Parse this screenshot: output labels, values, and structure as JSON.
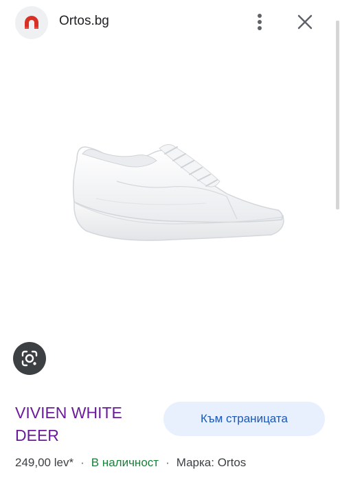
{
  "header": {
    "site_name": "Ortos.bg",
    "logo_icon": "magnet-logo-icon",
    "more_icon": "more-vert-icon",
    "close_icon": "close-icon"
  },
  "product": {
    "image_icon": "white-sneaker-image",
    "title": "VIVIEN WHITE DEER",
    "price": "249,00 lev*",
    "availability": "В наличност",
    "brand": "Марка: Ortos"
  },
  "actions": {
    "visit_label": "Към страницата",
    "lens_icon": "google-lens-icon"
  },
  "colors": {
    "title": "#6a1b9a",
    "availability": "#188038",
    "button_bg": "#e8f0fe",
    "button_text": "#1a56b5",
    "logo_red": "#d93025"
  }
}
